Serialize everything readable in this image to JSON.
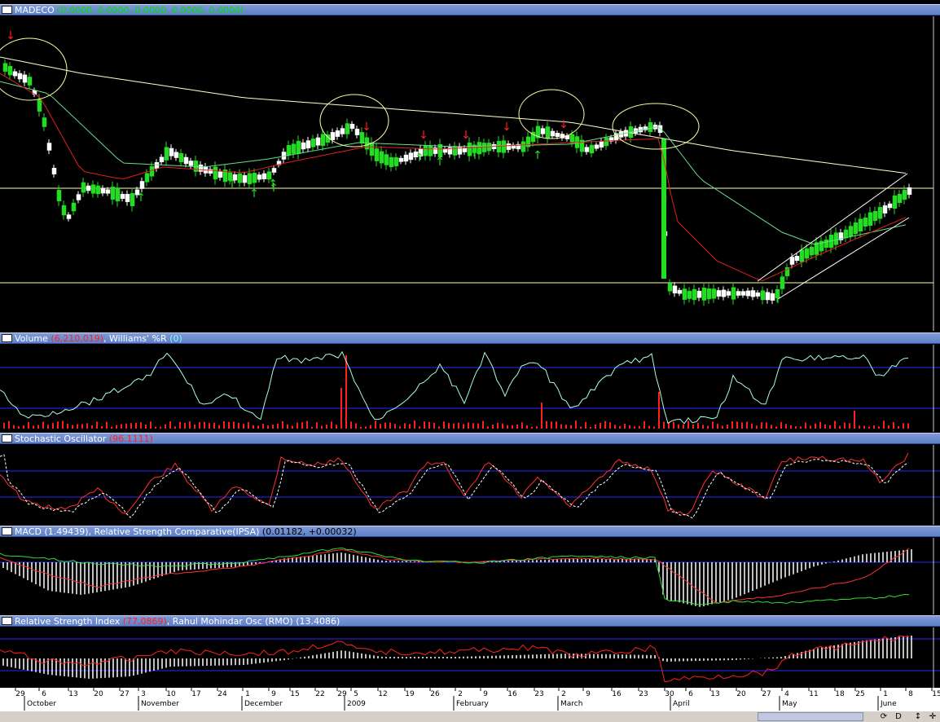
{
  "price_pane": {
    "symbol": "MADECO",
    "values_text": "(0.0000, 0.0000, 0.0000, 0.0000, 0.0000)"
  },
  "volume_pane": {
    "label1": "Volume",
    "value1": "(6,210,019)",
    "label2": ", Williams' %R",
    "value2": "(0)"
  },
  "stoch_pane": {
    "label": "Stochastic Oscillator",
    "value": "(96.1111)"
  },
  "macd_pane": {
    "label1": "MACD",
    "value1": "(1.49439)",
    "label2": ", Relative Strength Comparative(IPSA)",
    "value2": "(0.01182, +0.00032)"
  },
  "rsi_pane": {
    "label1": "Relative Strength Index",
    "value1": "(77.0869)",
    "label2": ", Rahul Mohindar Osc (RMO)",
    "value2": "(13.4086)"
  },
  "x_axis": {
    "days": [
      "29",
      "6",
      "13",
      "20",
      "27",
      "3",
      "10",
      "17",
      "24",
      "1",
      "9",
      "15",
      "22",
      "29",
      "5",
      "12",
      "19",
      "26",
      "2",
      "9",
      "16",
      "23",
      "2",
      "9",
      "16",
      "23",
      "30",
      "6",
      "13",
      "20",
      "27",
      "4",
      "11",
      "18",
      "25",
      "1",
      "8",
      "15"
    ],
    "months": [
      "October",
      "November",
      "December",
      "2009",
      "February",
      "March",
      "April",
      "May",
      "June"
    ]
  },
  "statusbar": {
    "btn1": "⟳",
    "btn2": "D",
    "btn3": "↕",
    "btn4": "✛"
  },
  "colors": {
    "header": "#5f80c8",
    "up": "#22dd22",
    "down": "#ffffff",
    "ma_fast": "#e02020",
    "ma_mid": "#66dd88",
    "ma_slow": "#ffffcc",
    "volume": "#ff2020",
    "grid": "#2a2aff"
  }
}
